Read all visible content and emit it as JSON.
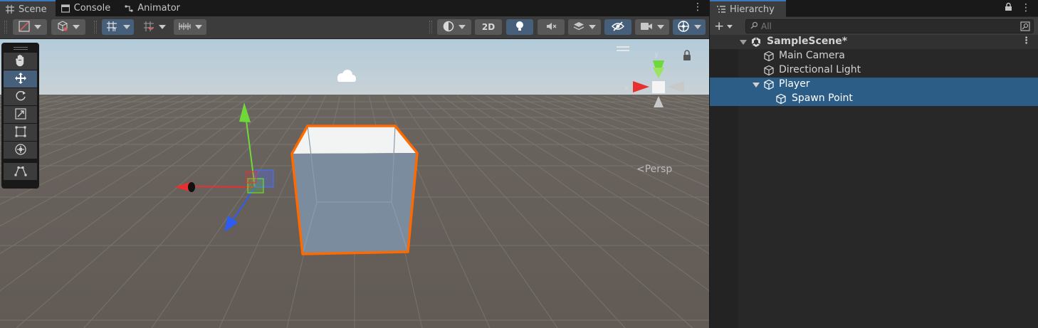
{
  "scene_tabs": [
    {
      "label": "Scene",
      "icon": "grid-icon",
      "active": true
    },
    {
      "label": "Console",
      "icon": "console-icon",
      "active": false
    },
    {
      "label": "Animator",
      "icon": "animator-icon",
      "active": false
    }
  ],
  "scene_toolbar": {
    "toggle_2d_label": "2D"
  },
  "viewport": {
    "camera_mode": "<Persp",
    "gizmo_axes": {
      "x": "x",
      "y": "y"
    },
    "sky_color": "#b6ccd9",
    "ground_color": "#645d57",
    "selection_outline_color": "#ff6a00"
  },
  "hierarchy": {
    "tab_label": "Hierarchy",
    "search_placeholder": "All",
    "scene_name": "SampleScene*",
    "items": [
      {
        "label": "Main Camera",
        "depth": 1,
        "selected": false,
        "expandable": false
      },
      {
        "label": "Directional Light",
        "depth": 1,
        "selected": false,
        "expandable": false
      },
      {
        "label": "Player",
        "depth": 1,
        "selected": true,
        "expandable": true
      },
      {
        "label": "Spawn Point",
        "depth": 2,
        "selected": true,
        "expandable": false
      }
    ]
  },
  "colors": {
    "accent_blue": "#3a79bb",
    "selected_row": "#2c5d87",
    "toggle_on": "#46607c"
  }
}
